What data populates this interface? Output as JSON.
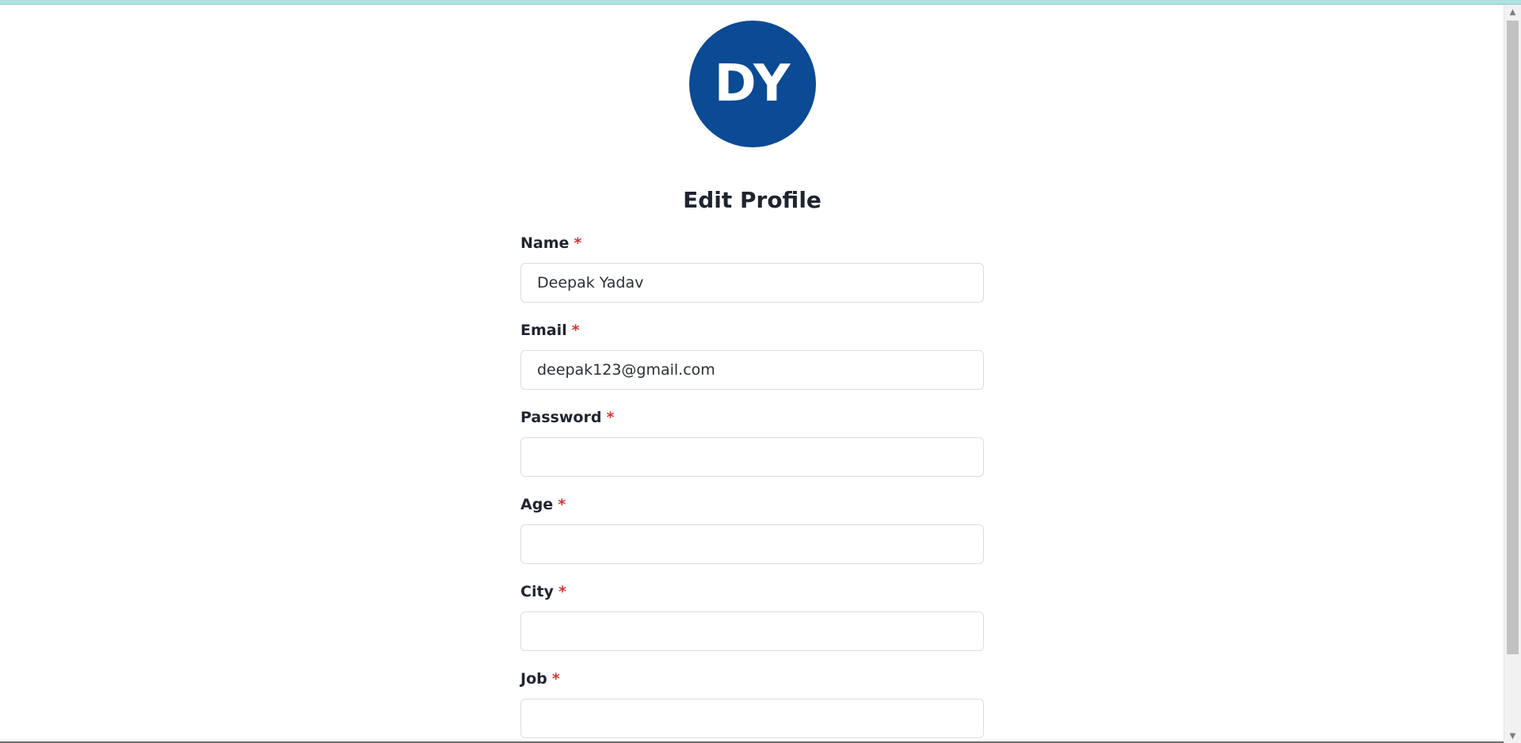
{
  "avatar": {
    "initials": "DY"
  },
  "title": "Edit Profile",
  "required_marker": "*",
  "fields": [
    {
      "label": "Name",
      "value": "Deepak Yadav",
      "placeholder": ""
    },
    {
      "label": "Email",
      "value": "deepak123@gmail.com",
      "placeholder": ""
    },
    {
      "label": "Password",
      "value": "",
      "placeholder": ""
    },
    {
      "label": "Age",
      "value": "",
      "placeholder": ""
    },
    {
      "label": "City",
      "value": "",
      "placeholder": ""
    },
    {
      "label": "Job",
      "value": "",
      "placeholder": ""
    }
  ],
  "colors": {
    "avatar_bg": "#0b4a94",
    "required": "#d53636",
    "top_accent": "#aee3e2"
  },
  "icons": {
    "scroll_up": "triangle-up-icon",
    "scroll_down": "triangle-down-icon"
  }
}
